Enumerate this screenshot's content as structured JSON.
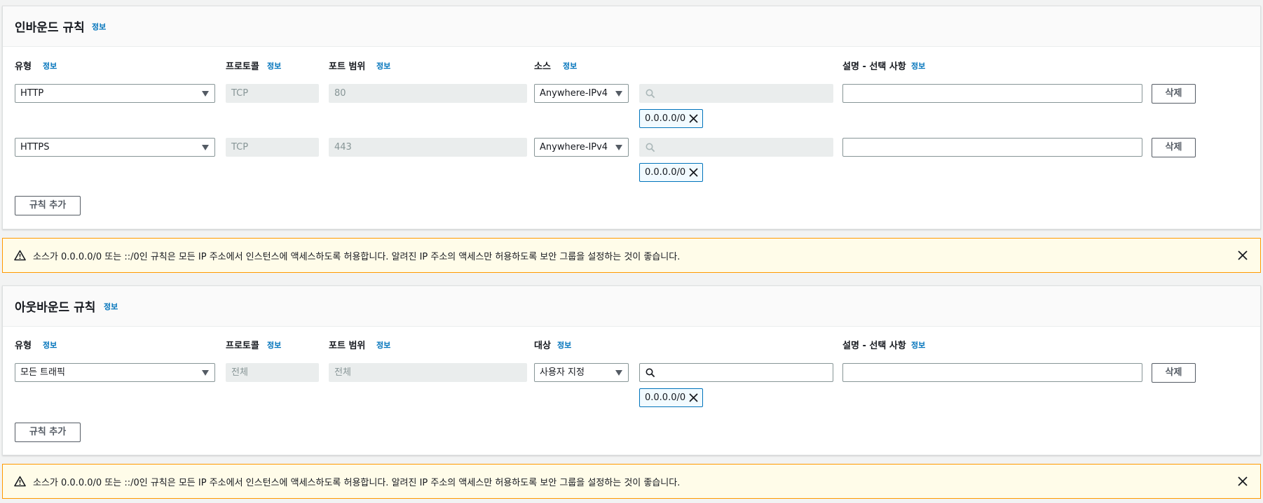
{
  "inbound": {
    "title": "인바운드 규칙",
    "info": "정보",
    "columns": {
      "type": "유형",
      "protocol": "프로토콜",
      "port_range": "포트 범위",
      "source": "소스",
      "description": "설명 - 선택 사항"
    },
    "rows": [
      {
        "type": "HTTP",
        "protocol": "TCP",
        "port": "80",
        "source_type": "Anywhere-IPv4",
        "search_value": "",
        "cidr": "0.0.0.0/0",
        "description": "",
        "delete": "삭제"
      },
      {
        "type": "HTTPS",
        "protocol": "TCP",
        "port": "443",
        "source_type": "Anywhere-IPv4",
        "search_value": "",
        "cidr": "0.0.0.0/0",
        "description": "",
        "delete": "삭제"
      }
    ],
    "add_rule": "규칙 추가"
  },
  "inbound_warning": "소스가 0.0.0.0/0 또는 ::/0인 규칙은 모든 IP 주소에서 인스턴스에 액세스하도록 허용합니다. 알려진 IP 주소의 액세스만 허용하도록 보안 그룹을 설정하는 것이 좋습니다.",
  "outbound": {
    "title": "아웃바운드 규칙",
    "info": "정보",
    "columns": {
      "type": "유형",
      "protocol": "프로토콜",
      "port_range": "포트 범위",
      "destination": "대상",
      "description": "설명 - 선택 사항"
    },
    "rows": [
      {
        "type": "모든 트래픽",
        "protocol": "전체",
        "port": "전체",
        "dest_type": "사용자 지정",
        "search_value": "",
        "cidr": "0.0.0.0/0",
        "description": "",
        "delete": "삭제"
      }
    ],
    "add_rule": "규칙 추가"
  },
  "outbound_warning": "소스가 0.0.0.0/0 또는 ::/0인 규칙은 모든 IP 주소에서 인스턴스에 액세스하도록 허용합니다. 알려진 IP 주소의 액세스만 허용하도록 보안 그룹을 설정하는 것이 좋습니다.",
  "icons": {
    "search": "search-icon",
    "remove": "close-icon",
    "warning": "warning-icon",
    "dropdown": "caret-down-icon"
  },
  "colors": {
    "link": "#0073bb",
    "warning_border": "#ff9900",
    "warning_bg": "#fffce9"
  }
}
